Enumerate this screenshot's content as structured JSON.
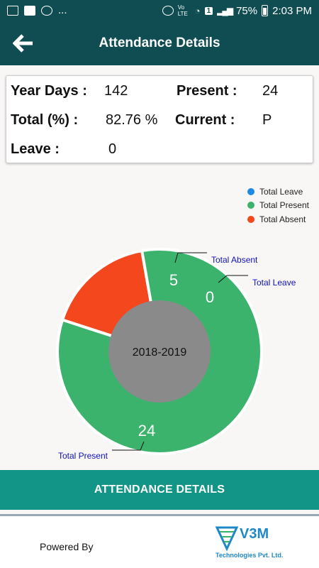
{
  "status_bar": {
    "battery": "75%",
    "time": "2:03 PM",
    "more": "...",
    "volte": "Vo LTE",
    "sim_slot": "1"
  },
  "header": {
    "title": "Attendance Details"
  },
  "summary": {
    "year_days_label": "Year Days :",
    "year_days_value": "142",
    "present_label": "Present :",
    "present_value": "24",
    "total_label": "Total (%) :",
    "total_value": "82.76 %",
    "current_label": "Current :",
    "current_value": "P",
    "leave_label": "Leave :",
    "leave_value": "0"
  },
  "legend": [
    {
      "label": "Total Leave",
      "color": "#1e88e5"
    },
    {
      "label": "Total Present",
      "color": "#3bb36d"
    },
    {
      "label": "Total Absent",
      "color": "#f4471e"
    }
  ],
  "chart_data": {
    "type": "pie",
    "center_text": "2018-2019",
    "slices": [
      {
        "label": "Total Absent",
        "value": 5,
        "color": "#f4471e"
      },
      {
        "label": "Total Leave",
        "value": 0,
        "color": "#1e88e5"
      },
      {
        "label": "Total Present",
        "value": 24,
        "color": "#3bb36d"
      }
    ],
    "hole_color": "#8a8a8a",
    "legend_position": "top-right"
  },
  "details_button": {
    "label": "ATTENDANCE DETAILS"
  },
  "footer": {
    "powered_by": "Powered By",
    "logo_name": "V3M",
    "logo_sub": "Technologies Pvt. Ltd."
  }
}
